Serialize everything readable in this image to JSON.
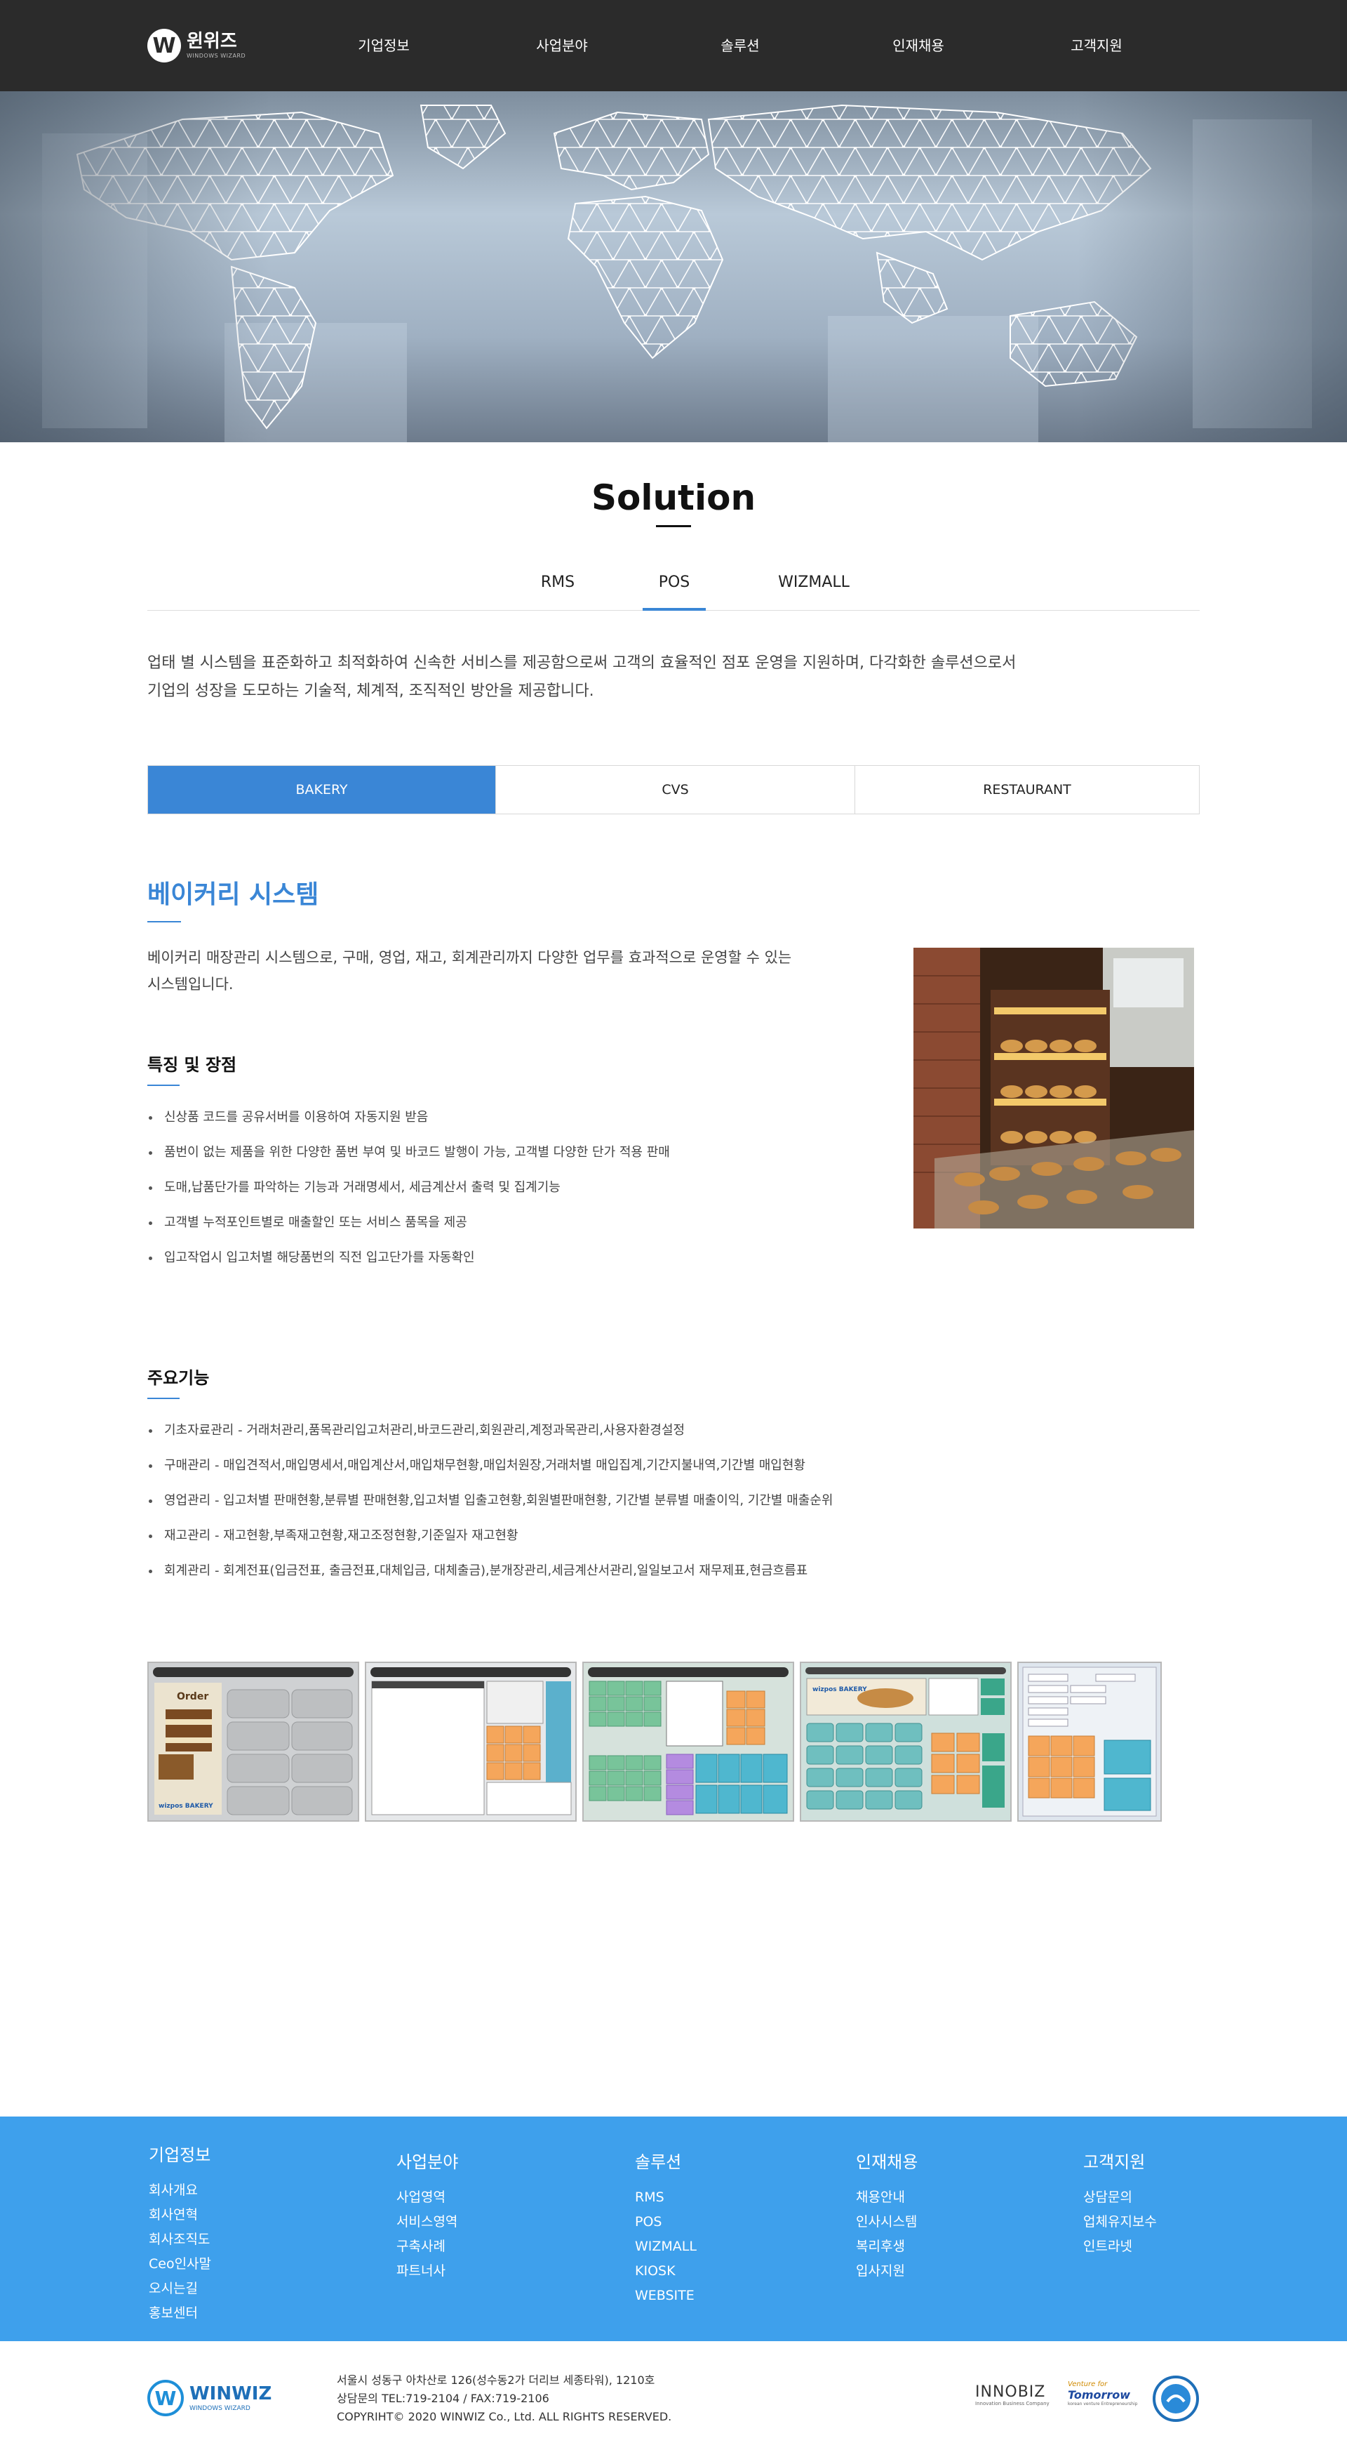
{
  "header": {
    "logo_text": "윈위즈",
    "logo_sub": "WINDOWS WIZARD",
    "logo_mark": "W",
    "nav": [
      "기업정보",
      "사업분야",
      "솔루션",
      "인재채용",
      "고객지원"
    ]
  },
  "page": {
    "title": "Solution",
    "solution_tabs": [
      "RMS",
      "POS",
      "WIZMALL"
    ],
    "active_solution_tab": "POS",
    "intro_lines": [
      "업태 별 시스템을 표준화하고 최적화하여 신속한 서비스를 제공함으로써 고객의 효율적인 점포 운영을 지원하며, 다각화한 솔루션으로서",
      "기업의 성장을 도모하는 기술적, 체계적, 조직적인 방안을 제공합니다."
    ],
    "category_tabs": [
      "BAKERY",
      "CVS",
      "RESTAURANT"
    ],
    "active_category_tab": "BAKERY"
  },
  "section": {
    "title": "베이커리 시스템",
    "desc_lines": [
      "베이커리 매장관리 시스템으로, 구매, 영업, 재고, 회계관리까지 다양한 업무를 효과적으로 운영할 수 있는",
      "시스템입니다."
    ],
    "features_title": "특징 및 장점",
    "features": [
      "신상품 코드를 공유서버를 이용하여 자동지원 받음",
      "품번이 없는 제품을 위한 다양한 품번 부여 및 바코드 발행이 가능, 고객별 다양한 단가 적용 판매",
      "도매,납품단가를 파악하는 기능과 거래명세서, 세금계산서 출력 및 집계기능",
      "고객별 누적포인트별로 매출할인 또는 서비스 품목을 제공",
      "입고작업시 입고처별 해당품번의 직전 입고단가를 자동확인"
    ],
    "functions_title": "주요기능",
    "functions": [
      "기초자료관리 - 거래처관리,품목관리입고처관리,바코드관리,회원관리,계정과목관리,사용자환경설정",
      "구매관리 - 매입견적서,매입명세서,매입계산서,매입채무현황,매입처원장,거래처별 매입집계,기간지불내역,기간별 매입현황",
      "영업관리 - 입고처별 판매현황,분류별 판매현황,입고처별 입출고현황,회원별판매현황, 기간별 분류별 매출이익, 기간별 매출순위",
      "재고관리 - 재고현황,부족재고현황,재고조정현황,기준일자 재고현황",
      "회계관리 - 회계전표(입금전표, 출금전표,대체입금, 대체출금),분개장관리,세금계산서관리,일일보고서 재무제표,현금흐름표"
    ],
    "screenshot_text": {
      "order": "Order",
      "bakery_logo": "wizpos BAKERY"
    }
  },
  "footer": {
    "columns": [
      {
        "title": "기업정보",
        "links": [
          "회사개요",
          "회사연혁",
          "회사조직도",
          "Ceo인사말",
          "오시는길",
          "홍보센터"
        ]
      },
      {
        "title": "사업분야",
        "links": [
          "사업영역",
          "서비스영역",
          "구축사례",
          "파트너사"
        ]
      },
      {
        "title": "솔루션",
        "links": [
          "RMS",
          "POS",
          "WIZMALL",
          "KIOSK",
          "WEBSITE"
        ]
      },
      {
        "title": "인재채용",
        "links": [
          "채용안내",
          "인사시스템",
          "복리후생",
          "입사지원"
        ]
      },
      {
        "title": "고객지원",
        "links": [
          "상담문의",
          "업체유지보수",
          "인트라넷"
        ]
      }
    ],
    "logo_text": "WINWIZ",
    "logo_sub": "WINDOWS WIZARD",
    "logo_mark": "W",
    "address": "서울시 성동구 아차산로 126(성수동2가 더리브 세종타워), 1210호",
    "tel": "상담문의 TEL:719-2104 / FAX:719-2106",
    "copyright": "COPYRIHT© 2020 WINWIZ Co., Ltd. ALL RIGHTS RESERVED.",
    "cert_innobiz": "INNOBIZ",
    "cert_innobiz_sub": "Innovation Business Company",
    "cert_venture": "Venture for",
    "cert_venture_big": "Tomorrow",
    "cert_venture_sub": "korean venture Entrepreneurship"
  },
  "colors": {
    "header_bg": "#2b2b2b",
    "accent": "#3a86d6",
    "footer_bg": "#3ea0ec"
  }
}
